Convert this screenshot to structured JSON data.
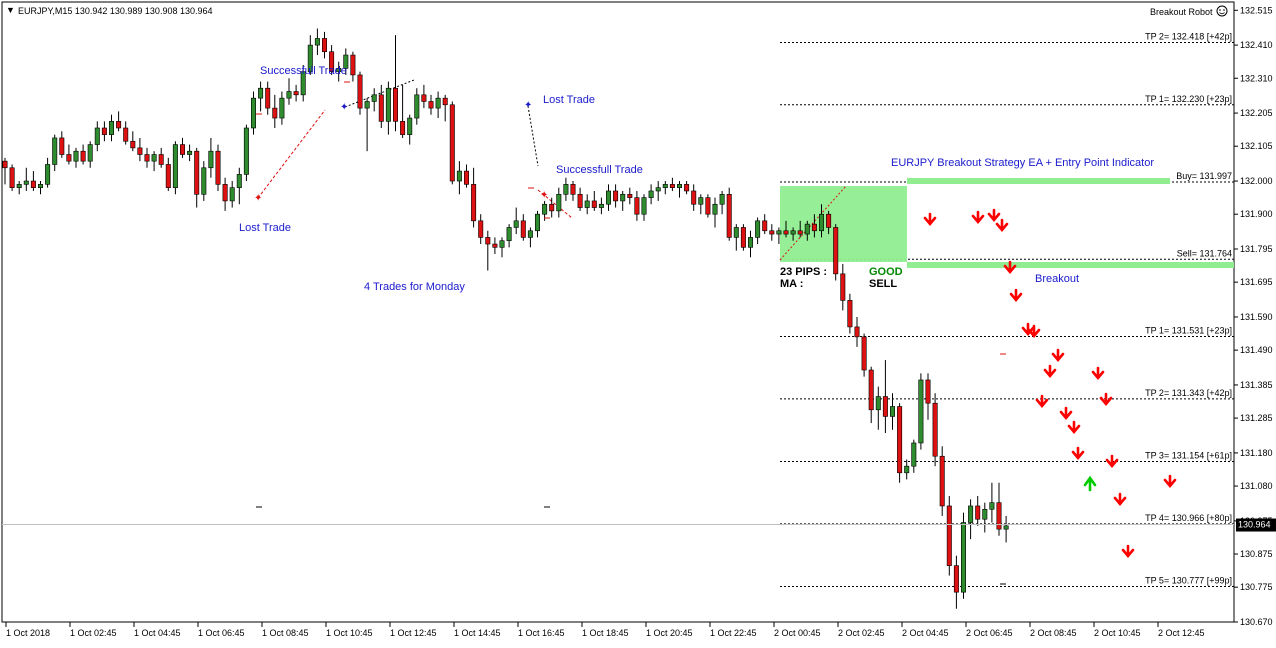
{
  "header": {
    "symbol_info": "EURJPY,M15  130.942 130.989 130.908 130.964",
    "robot_label": "Breakout Robot"
  },
  "colors": {
    "bull": "#2e8b2e",
    "bear": "#dd1111",
    "box": "#90ee90",
    "annotation": "#1a1acc",
    "arrow_down": "#ff0000",
    "arrow_up": "#00cc00",
    "current_price_bg": "#000000"
  },
  "icons": {
    "robot": "smiley-icon"
  },
  "annotations": {
    "successful_1": "Successfull Trade",
    "lost_1": "Lost Trade",
    "lost_2": "Lost Trade",
    "successful_2": "Successfull Trade",
    "monday": "4 Trades for Monday",
    "strategy_title": "EURJPY Breakout Strategy EA + Entry Point Indicator",
    "breakout": "Breakout",
    "pips": "23 PIPS :",
    "ma": "MA :",
    "good": "GOOD",
    "sell": "SELL"
  },
  "chart_data": {
    "type": "candlestick",
    "symbol": "EURJPY",
    "timeframe": "M15",
    "y_ticks": [
      132.515,
      132.41,
      132.31,
      132.205,
      132.105,
      132.0,
      131.9,
      131.795,
      131.695,
      131.59,
      131.49,
      131.385,
      131.285,
      131.18,
      131.08,
      130.975,
      130.875,
      130.775,
      130.67
    ],
    "ylim": [
      130.67,
      132.54
    ],
    "x_ticks": [
      "1 Oct 2018",
      "1 Oct 02:45",
      "1 Oct 04:45",
      "1 Oct 06:45",
      "1 Oct 08:45",
      "1 Oct 10:45",
      "1 Oct 12:45",
      "1 Oct 14:45",
      "1 Oct 16:45",
      "1 Oct 18:45",
      "1 Oct 20:45",
      "1 Oct 22:45",
      "2 Oct 00:45",
      "2 Oct 02:45",
      "2 Oct 04:45",
      "2 Oct 06:45",
      "2 Oct 08:45",
      "2 Oct 10:45",
      "2 Oct 12:45"
    ],
    "current_price": 130.964,
    "levels": [
      {
        "label": "TP 2= 132.418  [+42p]",
        "price": 132.418
      },
      {
        "label": "TP 1= 132.230  [+23p]",
        "price": 132.23
      },
      {
        "label": "Buy= 131.997",
        "price": 131.997
      },
      {
        "label": "Sell= 131.764",
        "price": 131.764
      },
      {
        "label": "TP 1= 131.531  [+23p]",
        "price": 131.531
      },
      {
        "label": "TP 2= 131.343  [+42p]",
        "price": 131.343
      },
      {
        "label": "TP 3= 131.154  [+61p]",
        "price": 131.154
      },
      {
        "label": "TP 4= 130.966  [+80p]",
        "price": 130.966
      },
      {
        "label": "TP 5= 130.777  [+99p]",
        "price": 130.777
      }
    ],
    "candles": [
      [
        132.06,
        132.07,
        131.99,
        132.04
      ],
      [
        132.04,
        132.05,
        131.97,
        131.98
      ],
      [
        131.98,
        132.0,
        131.96,
        131.99
      ],
      [
        131.99,
        132.04,
        131.97,
        132.0
      ],
      [
        132.0,
        132.03,
        131.97,
        131.98
      ],
      [
        131.98,
        132.0,
        131.96,
        131.99
      ],
      [
        131.99,
        132.07,
        131.98,
        132.05
      ],
      [
        132.05,
        132.14,
        132.03,
        132.13
      ],
      [
        132.13,
        132.15,
        132.07,
        132.08
      ],
      [
        132.08,
        132.11,
        132.05,
        132.06
      ],
      [
        132.06,
        132.1,
        132.04,
        132.09
      ],
      [
        132.09,
        132.11,
        132.05,
        132.06
      ],
      [
        132.06,
        132.12,
        132.04,
        132.11
      ],
      [
        132.11,
        132.18,
        132.09,
        132.16
      ],
      [
        132.16,
        132.18,
        132.12,
        132.14
      ],
      [
        132.14,
        132.2,
        132.12,
        132.18
      ],
      [
        132.18,
        132.21,
        132.15,
        132.16
      ],
      [
        132.16,
        132.18,
        132.11,
        132.12
      ],
      [
        132.12,
        132.15,
        132.09,
        132.1
      ],
      [
        132.1,
        132.13,
        132.06,
        132.08
      ],
      [
        132.08,
        132.1,
        132.04,
        132.06
      ],
      [
        132.06,
        132.09,
        132.03,
        132.08
      ],
      [
        132.08,
        132.1,
        132.04,
        132.05
      ],
      [
        132.05,
        132.07,
        131.97,
        131.98
      ],
      [
        131.98,
        132.12,
        131.96,
        132.11
      ],
      [
        132.11,
        132.13,
        132.07,
        132.08
      ],
      [
        132.08,
        132.11,
        132.06,
        132.09
      ],
      [
        132.09,
        132.1,
        131.92,
        131.96
      ],
      [
        131.96,
        132.06,
        131.94,
        132.04
      ],
      [
        132.04,
        132.13,
        132.01,
        132.09
      ],
      [
        132.09,
        132.11,
        131.97,
        131.99
      ],
      [
        131.99,
        132.01,
        131.91,
        131.94
      ],
      [
        131.94,
        132.0,
        131.92,
        131.98
      ],
      [
        131.98,
        132.04,
        131.93,
        132.02
      ],
      [
        132.02,
        132.17,
        132.0,
        132.16
      ],
      [
        132.16,
        132.27,
        132.14,
        132.25
      ],
      [
        132.25,
        132.3,
        132.21,
        132.28
      ],
      [
        132.28,
        132.3,
        132.2,
        132.22
      ],
      [
        132.22,
        132.26,
        132.16,
        132.19
      ],
      [
        132.19,
        132.27,
        132.17,
        132.25
      ],
      [
        132.25,
        132.31,
        132.23,
        132.27
      ],
      [
        132.27,
        132.29,
        132.24,
        132.26
      ],
      [
        132.26,
        132.35,
        132.24,
        132.33
      ],
      [
        132.33,
        132.44,
        132.32,
        132.41
      ],
      [
        132.41,
        132.46,
        132.38,
        132.43
      ],
      [
        132.43,
        132.45,
        132.37,
        132.39
      ],
      [
        132.39,
        132.41,
        132.32,
        132.33
      ],
      [
        132.33,
        132.36,
        132.3,
        132.34
      ],
      [
        132.34,
        132.4,
        132.32,
        132.38
      ],
      [
        132.38,
        132.39,
        132.3,
        132.32
      ],
      [
        132.32,
        132.33,
        132.2,
        132.22
      ],
      [
        132.22,
        132.25,
        132.09,
        132.24
      ],
      [
        132.24,
        132.28,
        132.21,
        132.26
      ],
      [
        132.26,
        132.29,
        132.16,
        132.18
      ],
      [
        132.18,
        132.3,
        132.14,
        132.28
      ],
      [
        132.28,
        132.44,
        132.15,
        132.18
      ],
      [
        132.18,
        132.29,
        132.13,
        132.14
      ],
      [
        132.14,
        132.2,
        132.11,
        132.19
      ],
      [
        132.19,
        132.28,
        132.17,
        132.26
      ],
      [
        132.26,
        132.29,
        132.22,
        132.24
      ],
      [
        132.24,
        132.26,
        132.2,
        132.22
      ],
      [
        132.22,
        132.27,
        132.19,
        132.25
      ],
      [
        132.25,
        132.26,
        132.18,
        132.23
      ],
      [
        132.23,
        132.24,
        131.99,
        132.0
      ],
      [
        132.0,
        132.06,
        131.96,
        132.03
      ],
      [
        132.03,
        132.05,
        131.98,
        131.99
      ],
      [
        131.99,
        132.04,
        131.86,
        131.88
      ],
      [
        131.88,
        131.9,
        131.81,
        131.83
      ],
      [
        131.83,
        131.85,
        131.73,
        131.81
      ],
      [
        131.81,
        131.83,
        131.78,
        131.8
      ],
      [
        131.8,
        131.83,
        131.77,
        131.82
      ],
      [
        131.82,
        131.87,
        131.8,
        131.86
      ],
      [
        131.86,
        131.92,
        131.84,
        131.88
      ],
      [
        131.88,
        131.9,
        131.82,
        131.83
      ],
      [
        131.83,
        131.86,
        131.8,
        131.85
      ],
      [
        131.85,
        131.91,
        131.83,
        131.9
      ],
      [
        131.9,
        131.94,
        131.88,
        131.93
      ],
      [
        131.93,
        131.95,
        131.89,
        131.91
      ],
      [
        131.91,
        131.98,
        131.89,
        131.96
      ],
      [
        131.96,
        132.01,
        131.94,
        131.99
      ],
      [
        131.99,
        132.0,
        131.94,
        131.96
      ],
      [
        131.96,
        131.98,
        131.91,
        131.92
      ],
      [
        131.92,
        131.96,
        131.9,
        131.94
      ],
      [
        131.94,
        131.97,
        131.91,
        131.92
      ],
      [
        131.92,
        131.95,
        131.9,
        131.93
      ],
      [
        131.93,
        131.99,
        131.91,
        131.97
      ],
      [
        131.97,
        131.99,
        131.92,
        131.94
      ],
      [
        131.94,
        131.97,
        131.91,
        131.96
      ],
      [
        131.96,
        131.98,
        131.93,
        131.95
      ],
      [
        131.95,
        131.97,
        131.88,
        131.9
      ],
      [
        131.9,
        131.96,
        131.88,
        131.95
      ],
      [
        131.95,
        131.99,
        131.93,
        131.97
      ],
      [
        131.97,
        132.0,
        131.94,
        131.98
      ],
      [
        131.98,
        132.0,
        131.96,
        131.99
      ],
      [
        131.99,
        132.01,
        131.97,
        131.98
      ],
      [
        131.98,
        132.0,
        131.95,
        131.99
      ],
      [
        131.99,
        132.0,
        131.96,
        131.97
      ],
      [
        131.97,
        131.99,
        131.91,
        131.93
      ],
      [
        131.93,
        131.96,
        131.9,
        131.95
      ],
      [
        131.95,
        131.96,
        131.89,
        131.9
      ],
      [
        131.9,
        131.95,
        131.86,
        131.93
      ],
      [
        131.93,
        131.97,
        131.9,
        131.96
      ],
      [
        131.96,
        131.98,
        131.82,
        131.83
      ],
      [
        131.83,
        131.87,
        131.79,
        131.86
      ],
      [
        131.86,
        131.87,
        131.79,
        131.8
      ],
      [
        131.8,
        131.85,
        131.77,
        131.83
      ],
      [
        131.83,
        131.89,
        131.81,
        131.88
      ],
      [
        131.88,
        131.9,
        131.84,
        131.85
      ],
      [
        131.85,
        131.87,
        131.82,
        131.84
      ],
      [
        131.84,
        131.86,
        131.81,
        131.85
      ],
      [
        131.85,
        131.88,
        131.83,
        131.84
      ],
      [
        131.84,
        131.86,
        131.82,
        131.85
      ],
      [
        131.85,
        131.88,
        131.83,
        131.84
      ],
      [
        131.84,
        131.88,
        131.82,
        131.87
      ],
      [
        131.87,
        131.9,
        131.83,
        131.85
      ],
      [
        131.85,
        131.93,
        131.83,
        131.9
      ],
      [
        131.9,
        131.91,
        131.84,
        131.86
      ],
      [
        131.86,
        131.87,
        131.7,
        131.72
      ],
      [
        131.72,
        131.75,
        131.61,
        131.64
      ],
      [
        131.64,
        131.66,
        131.54,
        131.56
      ],
      [
        131.56,
        131.59,
        131.5,
        131.53
      ],
      [
        131.53,
        131.54,
        131.41,
        131.43
      ],
      [
        131.43,
        131.44,
        131.27,
        131.31
      ],
      [
        131.31,
        131.38,
        131.25,
        131.35
      ],
      [
        131.35,
        131.46,
        131.24,
        131.29
      ],
      [
        131.29,
        131.36,
        131.25,
        131.32
      ],
      [
        131.32,
        131.33,
        131.09,
        131.12
      ],
      [
        131.12,
        131.16,
        131.1,
        131.14
      ],
      [
        131.14,
        131.22,
        131.12,
        131.21
      ],
      [
        131.21,
        131.42,
        131.19,
        131.4
      ],
      [
        131.4,
        131.42,
        131.28,
        131.33
      ],
      [
        131.33,
        131.36,
        131.14,
        131.17
      ],
      [
        131.17,
        131.2,
        130.99,
        131.02
      ],
      [
        131.02,
        131.05,
        130.81,
        130.84
      ],
      [
        130.84,
        130.87,
        130.71,
        130.76
      ],
      [
        130.76,
        131.0,
        130.74,
        130.97
      ],
      [
        130.97,
        131.04,
        130.92,
        131.02
      ],
      [
        131.02,
        131.05,
        130.96,
        130.98
      ],
      [
        130.98,
        131.03,
        130.94,
        131.01
      ],
      [
        131.01,
        131.09,
        130.97,
        131.03
      ],
      [
        131.03,
        131.09,
        130.93,
        130.95
      ],
      [
        130.95,
        130.99,
        130.91,
        130.96
      ]
    ]
  }
}
